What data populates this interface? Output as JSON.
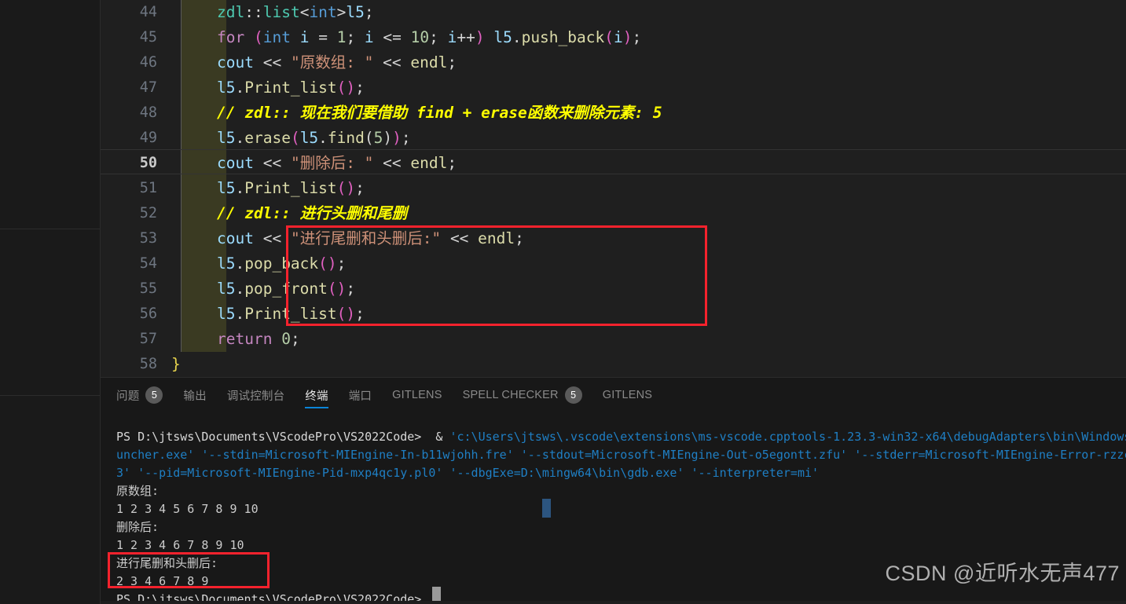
{
  "editor": {
    "first_line_number": 44,
    "active_line_number": 50,
    "lines": [
      {
        "n": "44",
        "tokens": [
          {
            "t": "zdl",
            "c": "t-type"
          },
          {
            "t": "::",
            "c": "t-punct"
          },
          {
            "t": "list",
            "c": "t-type"
          },
          {
            "t": "<",
            "c": "t-angle"
          },
          {
            "t": "int",
            "c": "t-kw2"
          },
          {
            "t": ">",
            "c": "t-angle"
          },
          {
            "t": "l5",
            "c": "t-var"
          },
          {
            "t": ";",
            "c": "t-punct"
          }
        ]
      },
      {
        "n": "45",
        "tokens": [
          {
            "t": "for",
            "c": "t-kw"
          },
          {
            "t": " ",
            "c": "t-op"
          },
          {
            "t": "(",
            "c": "t-paren"
          },
          {
            "t": "int",
            "c": "t-kw2"
          },
          {
            "t": " i ",
            "c": "t-var"
          },
          {
            "t": "= ",
            "c": "t-op"
          },
          {
            "t": "1",
            "c": "t-num"
          },
          {
            "t": "; ",
            "c": "t-punct"
          },
          {
            "t": "i ",
            "c": "t-var"
          },
          {
            "t": "<= ",
            "c": "t-op"
          },
          {
            "t": "10",
            "c": "t-num"
          },
          {
            "t": "; ",
            "c": "t-punct"
          },
          {
            "t": "i",
            "c": "t-var"
          },
          {
            "t": "++",
            "c": "t-op"
          },
          {
            "t": ")",
            "c": "t-paren"
          },
          {
            "t": " ",
            "c": "t-op"
          },
          {
            "t": "l5",
            "c": "t-var"
          },
          {
            "t": ".",
            "c": "t-punct"
          },
          {
            "t": "push_back",
            "c": "t-fn"
          },
          {
            "t": "(",
            "c": "t-paren"
          },
          {
            "t": "i",
            "c": "t-var"
          },
          {
            "t": ")",
            "c": "t-paren"
          },
          {
            "t": ";",
            "c": "t-punct"
          }
        ]
      },
      {
        "n": "46",
        "tokens": [
          {
            "t": "cout",
            "c": "t-var"
          },
          {
            "t": " ",
            "c": "t-op"
          },
          {
            "t": "<< ",
            "c": "t-op"
          },
          {
            "t": "\"原数组: \"",
            "c": "t-str"
          },
          {
            "t": " ",
            "c": "t-op"
          },
          {
            "t": "<< ",
            "c": "t-op"
          },
          {
            "t": "endl",
            "c": "t-fn"
          },
          {
            "t": ";",
            "c": "t-punct"
          }
        ]
      },
      {
        "n": "47",
        "tokens": [
          {
            "t": "l5",
            "c": "t-var"
          },
          {
            "t": ".",
            "c": "t-punct"
          },
          {
            "t": "Print_list",
            "c": "t-fn"
          },
          {
            "t": "(",
            "c": "t-paren"
          },
          {
            "t": ")",
            "c": "t-paren"
          },
          {
            "t": ";",
            "c": "t-punct"
          }
        ]
      },
      {
        "n": "48",
        "tokens": [
          {
            "t": "// zdl:: 现在我们要借助 find + erase函数来删除元素: 5",
            "c": "t-cmt"
          }
        ]
      },
      {
        "n": "49",
        "tokens": [
          {
            "t": "l5",
            "c": "t-var"
          },
          {
            "t": ".",
            "c": "t-punct"
          },
          {
            "t": "erase",
            "c": "t-fn"
          },
          {
            "t": "(",
            "c": "t-paren"
          },
          {
            "t": "l5",
            "c": "t-var"
          },
          {
            "t": ".",
            "c": "t-punct"
          },
          {
            "t": "find",
            "c": "t-fn"
          },
          {
            "t": "(",
            "c": "t-angle"
          },
          {
            "t": "5",
            "c": "t-num"
          },
          {
            "t": ")",
            "c": "t-angle"
          },
          {
            "t": ")",
            "c": "t-paren"
          },
          {
            "t": ";",
            "c": "t-punct"
          }
        ]
      },
      {
        "n": "50",
        "tokens": [
          {
            "t": "cout",
            "c": "t-var"
          },
          {
            "t": " ",
            "c": "t-op"
          },
          {
            "t": "<< ",
            "c": "t-op"
          },
          {
            "t": "\"删除后: \"",
            "c": "t-str"
          },
          {
            "t": " ",
            "c": "t-op"
          },
          {
            "t": "<< ",
            "c": "t-op"
          },
          {
            "t": "endl",
            "c": "t-fn"
          },
          {
            "t": ";",
            "c": "t-punct"
          }
        ]
      },
      {
        "n": "51",
        "tokens": [
          {
            "t": "l5",
            "c": "t-var"
          },
          {
            "t": ".",
            "c": "t-punct"
          },
          {
            "t": "Print_list",
            "c": "t-fn"
          },
          {
            "t": "(",
            "c": "t-paren"
          },
          {
            "t": ")",
            "c": "t-paren"
          },
          {
            "t": ";",
            "c": "t-punct"
          }
        ]
      },
      {
        "n": "52",
        "tokens": [
          {
            "t": "// zdl:: 进行头删和尾删",
            "c": "t-cmt"
          }
        ]
      },
      {
        "n": "53",
        "tokens": [
          {
            "t": "cout",
            "c": "t-var"
          },
          {
            "t": " ",
            "c": "t-op"
          },
          {
            "t": "<< ",
            "c": "t-op"
          },
          {
            "t": "\"进行尾删和头删后:\"",
            "c": "t-str"
          },
          {
            "t": " ",
            "c": "t-op"
          },
          {
            "t": "<< ",
            "c": "t-op"
          },
          {
            "t": "endl",
            "c": "t-fn"
          },
          {
            "t": ";",
            "c": "t-punct"
          }
        ]
      },
      {
        "n": "54",
        "tokens": [
          {
            "t": "l5",
            "c": "t-var"
          },
          {
            "t": ".",
            "c": "t-punct"
          },
          {
            "t": "pop_back",
            "c": "t-fn"
          },
          {
            "t": "(",
            "c": "t-paren"
          },
          {
            "t": ")",
            "c": "t-paren"
          },
          {
            "t": ";",
            "c": "t-punct"
          }
        ]
      },
      {
        "n": "55",
        "tokens": [
          {
            "t": "l5",
            "c": "t-var"
          },
          {
            "t": ".",
            "c": "t-punct"
          },
          {
            "t": "pop_front",
            "c": "t-fn"
          },
          {
            "t": "(",
            "c": "t-paren"
          },
          {
            "t": ")",
            "c": "t-paren"
          },
          {
            "t": ";",
            "c": "t-punct"
          }
        ]
      },
      {
        "n": "56",
        "tokens": [
          {
            "t": "l5",
            "c": "t-var"
          },
          {
            "t": ".",
            "c": "t-punct"
          },
          {
            "t": "Print_list",
            "c": "t-fn"
          },
          {
            "t": "(",
            "c": "t-paren"
          },
          {
            "t": ")",
            "c": "t-paren"
          },
          {
            "t": ";",
            "c": "t-punct"
          }
        ]
      },
      {
        "n": "57",
        "tokens": [
          {
            "t": "return",
            "c": "t-kw"
          },
          {
            "t": " ",
            "c": "t-op"
          },
          {
            "t": "0",
            "c": "t-num"
          },
          {
            "t": ";",
            "c": "t-punct"
          }
        ]
      },
      {
        "n": "58",
        "tokens": [
          {
            "t": "}",
            "c": "t-brace"
          }
        ],
        "unindented": true
      }
    ],
    "annotation_color": "#f5222d"
  },
  "panel": {
    "tabs": [
      {
        "label": "问题",
        "badge": "5",
        "active": false
      },
      {
        "label": "输出",
        "badge": "",
        "active": false
      },
      {
        "label": "调试控制台",
        "badge": "",
        "active": false
      },
      {
        "label": "终端",
        "badge": "",
        "active": true
      },
      {
        "label": "端口",
        "badge": "",
        "active": false
      },
      {
        "label": "GITLENS",
        "badge": "",
        "active": false
      },
      {
        "label": "SPELL CHECKER",
        "badge": "5",
        "active": false
      },
      {
        "label": "GITLENS",
        "badge": "",
        "active": false
      }
    ]
  },
  "terminal": {
    "lines": [
      [
        {
          "t": "PS D:\\jtsws\\Documents\\VScodePro\\VS2022Code>",
          "c": "c-ps"
        },
        {
          "t": "  & ",
          "c": "c-ps"
        },
        {
          "t": "'c:\\Users\\jtsws\\.vscode\\extensions\\ms-vscode.cpptools-1.23.3-win32-x64\\debugAdapters\\bin\\WindowsDebugLa",
          "c": "c-arg"
        }
      ],
      [
        {
          "t": "uncher.exe'",
          "c": "c-arg"
        },
        {
          "t": " ",
          "c": "c-ps"
        },
        {
          "t": "'--stdin=Microsoft-MIEngine-In-b11wjohh.fre'",
          "c": "c-arg"
        },
        {
          "t": " ",
          "c": "c-ps"
        },
        {
          "t": "'--stdout=Microsoft-MIEngine-Out-o5egontt.zfu'",
          "c": "c-arg"
        },
        {
          "t": " ",
          "c": "c-ps"
        },
        {
          "t": "'--stderr=Microsoft-MIEngine-Error-rzzckzo",
          "c": "c-arg"
        }
      ],
      [
        {
          "t": "3'",
          "c": "c-arg"
        },
        {
          "t": " ",
          "c": "c-ps"
        },
        {
          "t": "'--pid=Microsoft-MIEngine-Pid-mxp4qc1y.pl0'",
          "c": "c-arg"
        },
        {
          "t": " ",
          "c": "c-ps"
        },
        {
          "t": "'--dbgExe=D:\\mingw64\\bin\\gdb.exe'",
          "c": "c-arg"
        },
        {
          "t": " ",
          "c": "c-ps"
        },
        {
          "t": "'--interpreter=mi'",
          "c": "c-arg"
        }
      ],
      [
        {
          "t": "原数组:",
          "c": "c-out"
        }
      ],
      [
        {
          "t": "1 2 3 4 5 6 7 8 9 10",
          "c": "c-out"
        }
      ],
      [
        {
          "t": "删除后:",
          "c": "c-out"
        }
      ],
      [
        {
          "t": "1 2 3 4 6 7 8 9 10",
          "c": "c-out"
        }
      ],
      [
        {
          "t": "进行尾删和头删后:",
          "c": "c-out"
        }
      ],
      [
        {
          "t": "2 3 4 6 7 8 9",
          "c": "c-out"
        }
      ],
      [
        {
          "t": "PS D:\\jtsws\\Documents\\VScodePro\\VS2022Code>",
          "c": "c-ps"
        }
      ]
    ]
  },
  "watermark": {
    "text": "CSDN @近听水无声477"
  }
}
